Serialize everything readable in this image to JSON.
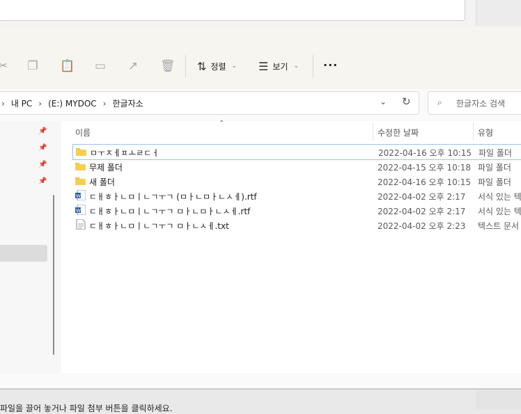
{
  "toolbar": {
    "sort_label": "정렬",
    "view_label": "보기",
    "more_label": "···"
  },
  "address": {
    "crumbs": [
      "내 PC",
      "(E:) MYDOC",
      "한글자소"
    ]
  },
  "search": {
    "placeholder": "한글자소 검색"
  },
  "columns": {
    "name": "이름",
    "date": "수정한 날짜",
    "type": "유형"
  },
  "files": [
    {
      "name": "ㅁㅜㅈㅔㅍㅗㄹㄷㅓ",
      "date": "2022-04-16 오후 10:15",
      "type": "파일 폴더",
      "kind": "folder"
    },
    {
      "name": "무제 폴더",
      "date": "2022-04-15 오후 10:18",
      "type": "파일 폴더",
      "kind": "folder"
    },
    {
      "name": "새 폴더",
      "date": "2022-04-16 오후 10:15",
      "type": "파일 폴더",
      "kind": "folder"
    },
    {
      "name": "ㄷㅐㅎㅏㄴㅁㅣㄴㄱㅜㄱ (ㅁㅏㄴㅁㅏㄴㅅㅔ).rtf",
      "date": "2022-04-02 오후 2:17",
      "type": "서식 있는 텍",
      "kind": "word"
    },
    {
      "name": "ㄷㅐㅎㅏㄴㅁㅣㄴㄱㅜㄱ ㅁㅏㄴㅁㅏㄴㅅㅔ.rtf",
      "date": "2022-04-02 오후 2:17",
      "type": "서식 있는 텍",
      "kind": "word"
    },
    {
      "name": "ㄷㅐㅎㅏㄴㅁㅣㄴㄱㅜㄱ ㅁㅏㄴㅅㅔ.txt",
      "date": "2022-04-02 오후 2:23",
      "type": "텍스트 문서",
      "kind": "text"
    }
  ],
  "status_text": "파일을 끌어 놓거나 파일 첨부 버튼을 클릭하세요."
}
